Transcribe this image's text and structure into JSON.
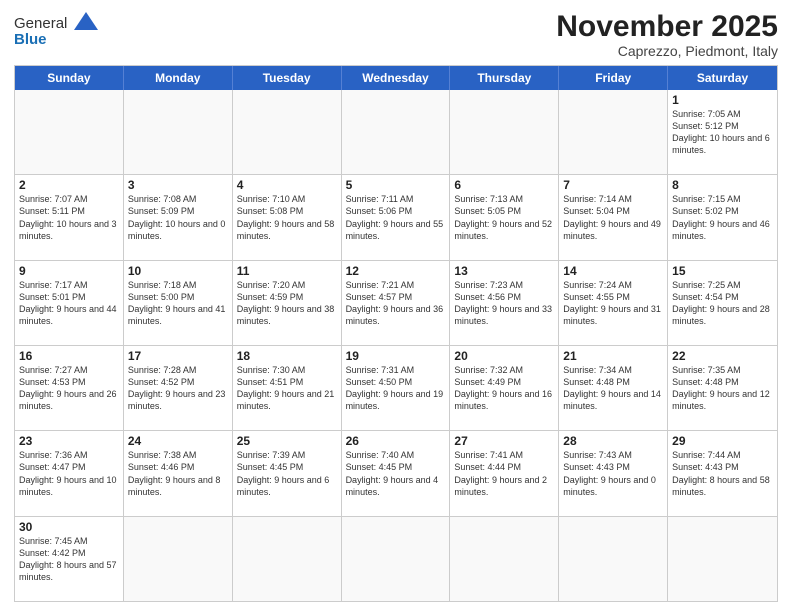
{
  "header": {
    "logo_general": "General",
    "logo_blue": "Blue",
    "month_title": "November 2025",
    "location": "Caprezzo, Piedmont, Italy"
  },
  "weekdays": [
    "Sunday",
    "Monday",
    "Tuesday",
    "Wednesday",
    "Thursday",
    "Friday",
    "Saturday"
  ],
  "weeks": [
    [
      {
        "day": "",
        "info": ""
      },
      {
        "day": "",
        "info": ""
      },
      {
        "day": "",
        "info": ""
      },
      {
        "day": "",
        "info": ""
      },
      {
        "day": "",
        "info": ""
      },
      {
        "day": "",
        "info": ""
      },
      {
        "day": "1",
        "info": "Sunrise: 7:05 AM\nSunset: 5:12 PM\nDaylight: 10 hours and 6 minutes."
      }
    ],
    [
      {
        "day": "2",
        "info": "Sunrise: 7:07 AM\nSunset: 5:11 PM\nDaylight: 10 hours and 3 minutes."
      },
      {
        "day": "3",
        "info": "Sunrise: 7:08 AM\nSunset: 5:09 PM\nDaylight: 10 hours and 0 minutes."
      },
      {
        "day": "4",
        "info": "Sunrise: 7:10 AM\nSunset: 5:08 PM\nDaylight: 9 hours and 58 minutes."
      },
      {
        "day": "5",
        "info": "Sunrise: 7:11 AM\nSunset: 5:06 PM\nDaylight: 9 hours and 55 minutes."
      },
      {
        "day": "6",
        "info": "Sunrise: 7:13 AM\nSunset: 5:05 PM\nDaylight: 9 hours and 52 minutes."
      },
      {
        "day": "7",
        "info": "Sunrise: 7:14 AM\nSunset: 5:04 PM\nDaylight: 9 hours and 49 minutes."
      },
      {
        "day": "8",
        "info": "Sunrise: 7:15 AM\nSunset: 5:02 PM\nDaylight: 9 hours and 46 minutes."
      }
    ],
    [
      {
        "day": "9",
        "info": "Sunrise: 7:17 AM\nSunset: 5:01 PM\nDaylight: 9 hours and 44 minutes."
      },
      {
        "day": "10",
        "info": "Sunrise: 7:18 AM\nSunset: 5:00 PM\nDaylight: 9 hours and 41 minutes."
      },
      {
        "day": "11",
        "info": "Sunrise: 7:20 AM\nSunset: 4:59 PM\nDaylight: 9 hours and 38 minutes."
      },
      {
        "day": "12",
        "info": "Sunrise: 7:21 AM\nSunset: 4:57 PM\nDaylight: 9 hours and 36 minutes."
      },
      {
        "day": "13",
        "info": "Sunrise: 7:23 AM\nSunset: 4:56 PM\nDaylight: 9 hours and 33 minutes."
      },
      {
        "day": "14",
        "info": "Sunrise: 7:24 AM\nSunset: 4:55 PM\nDaylight: 9 hours and 31 minutes."
      },
      {
        "day": "15",
        "info": "Sunrise: 7:25 AM\nSunset: 4:54 PM\nDaylight: 9 hours and 28 minutes."
      }
    ],
    [
      {
        "day": "16",
        "info": "Sunrise: 7:27 AM\nSunset: 4:53 PM\nDaylight: 9 hours and 26 minutes."
      },
      {
        "day": "17",
        "info": "Sunrise: 7:28 AM\nSunset: 4:52 PM\nDaylight: 9 hours and 23 minutes."
      },
      {
        "day": "18",
        "info": "Sunrise: 7:30 AM\nSunset: 4:51 PM\nDaylight: 9 hours and 21 minutes."
      },
      {
        "day": "19",
        "info": "Sunrise: 7:31 AM\nSunset: 4:50 PM\nDaylight: 9 hours and 19 minutes."
      },
      {
        "day": "20",
        "info": "Sunrise: 7:32 AM\nSunset: 4:49 PM\nDaylight: 9 hours and 16 minutes."
      },
      {
        "day": "21",
        "info": "Sunrise: 7:34 AM\nSunset: 4:48 PM\nDaylight: 9 hours and 14 minutes."
      },
      {
        "day": "22",
        "info": "Sunrise: 7:35 AM\nSunset: 4:48 PM\nDaylight: 9 hours and 12 minutes."
      }
    ],
    [
      {
        "day": "23",
        "info": "Sunrise: 7:36 AM\nSunset: 4:47 PM\nDaylight: 9 hours and 10 minutes."
      },
      {
        "day": "24",
        "info": "Sunrise: 7:38 AM\nSunset: 4:46 PM\nDaylight: 9 hours and 8 minutes."
      },
      {
        "day": "25",
        "info": "Sunrise: 7:39 AM\nSunset: 4:45 PM\nDaylight: 9 hours and 6 minutes."
      },
      {
        "day": "26",
        "info": "Sunrise: 7:40 AM\nSunset: 4:45 PM\nDaylight: 9 hours and 4 minutes."
      },
      {
        "day": "27",
        "info": "Sunrise: 7:41 AM\nSunset: 4:44 PM\nDaylight: 9 hours and 2 minutes."
      },
      {
        "day": "28",
        "info": "Sunrise: 7:43 AM\nSunset: 4:43 PM\nDaylight: 9 hours and 0 minutes."
      },
      {
        "day": "29",
        "info": "Sunrise: 7:44 AM\nSunset: 4:43 PM\nDaylight: 8 hours and 58 minutes."
      }
    ],
    [
      {
        "day": "30",
        "info": "Sunrise: 7:45 AM\nSunset: 4:42 PM\nDaylight: 8 hours and 57 minutes."
      },
      {
        "day": "",
        "info": ""
      },
      {
        "day": "",
        "info": ""
      },
      {
        "day": "",
        "info": ""
      },
      {
        "day": "",
        "info": ""
      },
      {
        "day": "",
        "info": ""
      },
      {
        "day": "",
        "info": ""
      }
    ]
  ]
}
